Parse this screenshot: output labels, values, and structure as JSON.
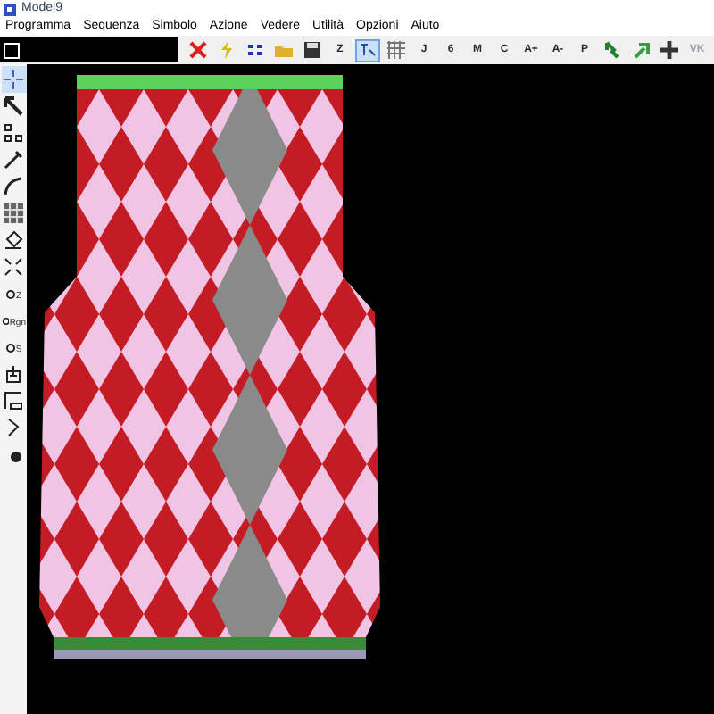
{
  "window": {
    "title": "Model9"
  },
  "menu": [
    "Programma",
    "Sequenza",
    "Simbolo",
    "Azione",
    "Vedere",
    "Utilità",
    "Opzioni",
    "Aiuto"
  ],
  "toolbar": [
    {
      "kind": "icon",
      "selected": false
    },
    {
      "kind": "icon",
      "selected": false
    },
    {
      "kind": "icon",
      "selected": false
    },
    {
      "kind": "icon",
      "selected": false
    },
    {
      "kind": "icon",
      "selected": false
    },
    {
      "kind": "text",
      "label": "Z",
      "selected": false
    },
    {
      "kind": "icon",
      "selected": true
    },
    {
      "kind": "icon",
      "selected": false
    },
    {
      "kind": "text",
      "label": "J",
      "selected": false
    },
    {
      "kind": "text",
      "label": "6",
      "selected": false
    },
    {
      "kind": "text",
      "label": "M",
      "selected": false
    },
    {
      "kind": "text",
      "label": "C",
      "selected": false
    },
    {
      "kind": "text",
      "label": "A+",
      "selected": false
    },
    {
      "kind": "text",
      "label": "A-",
      "selected": false
    },
    {
      "kind": "text",
      "label": "P",
      "selected": false
    },
    {
      "kind": "icon",
      "selected": false
    },
    {
      "kind": "icon",
      "selected": false
    },
    {
      "kind": "icon",
      "selected": false
    },
    {
      "kind": "text",
      "label": "VK",
      "selected": false,
      "disabled": true
    }
  ],
  "tools": [
    {
      "selected": true
    },
    {
      "selected": false
    },
    {
      "selected": false
    },
    {
      "selected": false
    },
    {
      "selected": false
    },
    {
      "selected": false
    },
    {
      "selected": false
    },
    {
      "selected": false
    },
    {
      "label": "Z",
      "selected": false
    },
    {
      "label": "Rgn",
      "selected": false
    },
    {
      "label": "S",
      "selected": false
    },
    {
      "selected": false
    },
    {
      "selected": false
    },
    {
      "selected": false
    },
    {
      "selected": false
    }
  ]
}
